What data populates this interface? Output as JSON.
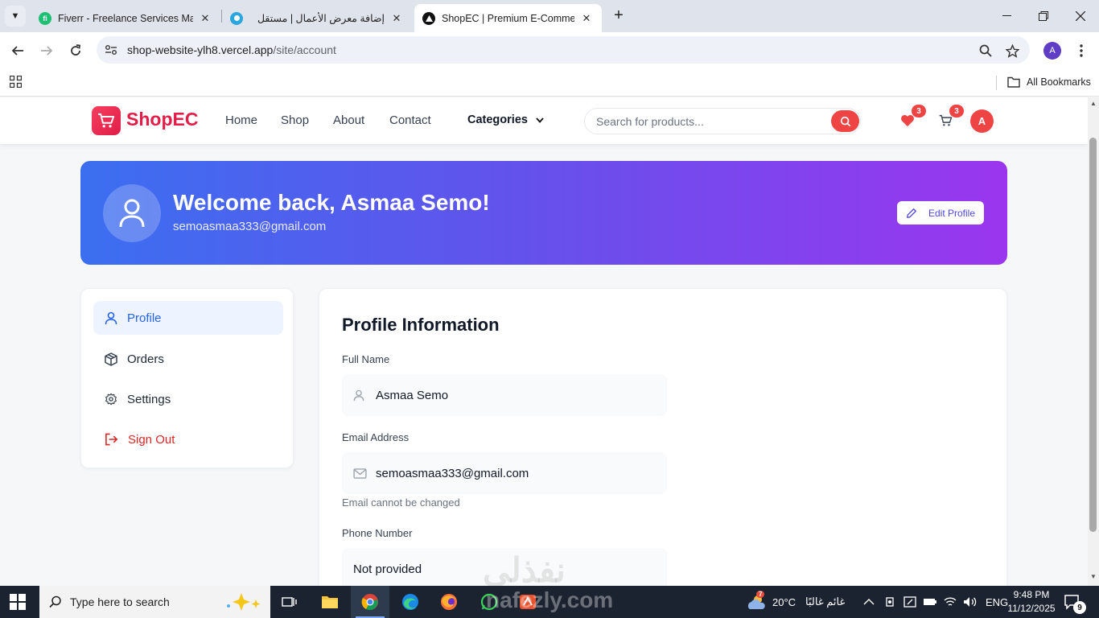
{
  "browser": {
    "tabs": [
      {
        "title": "Fiverr - Freelance Services Marketplace",
        "active": false
      },
      {
        "title": "إضافة معرض الأعمال | مستقل",
        "active": false
      },
      {
        "title": "ShopEC | Premium E-Commerce",
        "active": true
      }
    ],
    "url_host": "shop-website-ylh8.vercel.app",
    "url_path": "/site/account",
    "profile_initial": "A",
    "bookmarks_label": "All Bookmarks"
  },
  "site": {
    "brand": "ShopEC",
    "nav": [
      "Home",
      "Shop",
      "About",
      "Contact"
    ],
    "categories_label": "Categories",
    "search_placeholder": "Search for products...",
    "wishlist_count": "3",
    "cart_count": "3",
    "user_initial": "A"
  },
  "hero": {
    "title": "Welcome back, Asmaa Semo!",
    "email": "semoasmaa333@gmail.com",
    "edit_label": "Edit Profile"
  },
  "sidebar": {
    "items": [
      {
        "label": "Profile",
        "icon": "user-icon",
        "active": true
      },
      {
        "label": "Orders",
        "icon": "package-icon",
        "active": false
      },
      {
        "label": "Settings",
        "icon": "gear-icon",
        "active": false
      },
      {
        "label": "Sign Out",
        "icon": "sign-out-icon",
        "active": false
      }
    ]
  },
  "profile": {
    "title": "Profile Information",
    "full_name_label": "Full Name",
    "full_name": "Asmaa Semo",
    "email_label": "Email Address",
    "email": "semoasmaa333@gmail.com",
    "email_hint": "Email cannot be changed",
    "phone_label": "Phone Number",
    "phone": "Not provided"
  },
  "watermark": "نفذلي",
  "taskbar": {
    "search_placeholder": "Type here to search",
    "weather_temp": "20°C",
    "weather_text": "غائم غالبًا",
    "weather_badge": "7",
    "language": "ENG",
    "time": "9:48 PM",
    "date": "11/12/2025",
    "notification_count": "9",
    "watermark": "nafezly.com"
  },
  "colors": {
    "brand": "#e11d48",
    "accent": "#2563eb",
    "danger": "#dc2626",
    "hero_start": "#3b6ff0",
    "hero_end": "#9a36ee"
  }
}
